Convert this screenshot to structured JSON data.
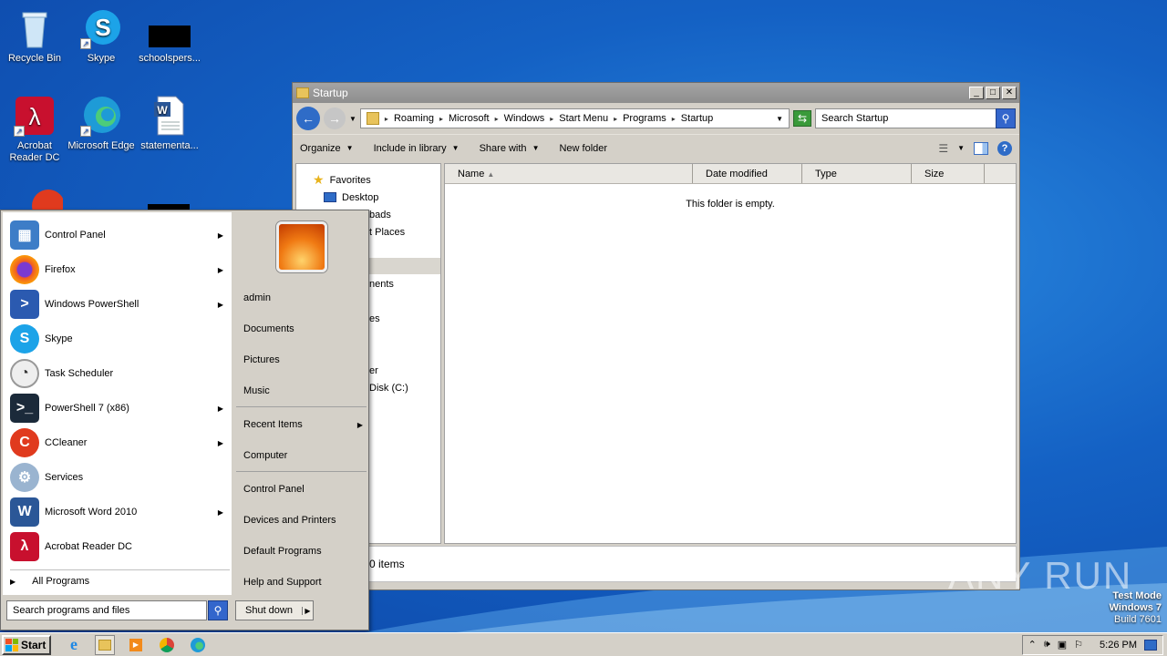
{
  "desktop": {
    "icons": [
      {
        "label": "Recycle Bin"
      },
      {
        "label": "Skype"
      },
      {
        "label": "schoolspers..."
      },
      {
        "label": "Acrobat Reader DC"
      },
      {
        "label": "Microsoft Edge"
      },
      {
        "label": "statementa..."
      }
    ],
    "watermark": "ANY RUN",
    "test_mode": {
      "line1": "Test Mode",
      "line2": "Windows 7",
      "line3": "Build 7601"
    }
  },
  "explorer": {
    "title": "Startup",
    "breadcrumbs": [
      "Roaming",
      "Microsoft",
      "Windows",
      "Start Menu",
      "Programs",
      "Startup"
    ],
    "search_placeholder": "Search Startup",
    "commands": {
      "organize": "Organize",
      "include": "Include in library",
      "share": "Share with",
      "new_folder": "New folder"
    },
    "nav": {
      "favorites": "Favorites",
      "desktop": "Desktop",
      "downloads_partial": "bads",
      "recent_partial": "t Places",
      "documents_partial": "nents",
      "pictures_partial": "es",
      "computer_partial": "er",
      "disk_partial": "Disk (C:)"
    },
    "columns": [
      "Name",
      "Date modified",
      "Type",
      "Size"
    ],
    "empty_text": "This folder is empty.",
    "details_text": "0 items"
  },
  "start_menu": {
    "programs": [
      {
        "label": "Control Panel",
        "icon": "control-panel-icon",
        "arrow": true
      },
      {
        "label": "Firefox",
        "icon": "firefox-icon",
        "arrow": true
      },
      {
        "label": "Windows PowerShell",
        "icon": "powershell-icon",
        "arrow": true
      },
      {
        "label": "Skype",
        "icon": "skype-icon",
        "arrow": false
      },
      {
        "label": "Task Scheduler",
        "icon": "clock-icon",
        "arrow": false
      },
      {
        "label": "PowerShell 7 (x86)",
        "icon": "powershell7-icon",
        "arrow": true
      },
      {
        "label": "CCleaner",
        "icon": "ccleaner-icon",
        "arrow": true
      },
      {
        "label": "Services",
        "icon": "gear-icon",
        "arrow": false
      },
      {
        "label": "Microsoft Word 2010",
        "icon": "word-icon",
        "arrow": true
      },
      {
        "label": "Acrobat Reader DC",
        "icon": "acrobat-icon",
        "arrow": false
      }
    ],
    "all_programs": "All Programs",
    "search_placeholder": "Search programs and files",
    "right": {
      "user": "admin",
      "documents": "Documents",
      "pictures": "Pictures",
      "music": "Music",
      "recent": "Recent Items",
      "computer": "Computer",
      "control_panel": "Control Panel",
      "devices": "Devices and Printers",
      "default_programs": "Default Programs",
      "help": "Help and Support"
    },
    "shutdown": "Shut down"
  },
  "taskbar": {
    "start": "Start",
    "clock": "5:26 PM"
  }
}
